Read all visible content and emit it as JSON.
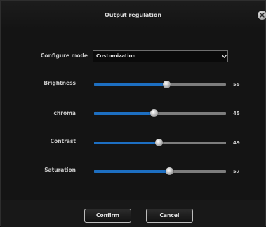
{
  "dialog": {
    "title": "Output regulation",
    "close_icon": "close-x-icon"
  },
  "configure_mode": {
    "label": "Configure mode",
    "value": "Customization",
    "arrow_icon": "chevron-down-icon"
  },
  "sliders": [
    {
      "key": "brightness",
      "label": "Brightness",
      "value": "55"
    },
    {
      "key": "chroma",
      "label": "chroma",
      "value": "45"
    },
    {
      "key": "contrast",
      "label": "Contrast",
      "value": "49"
    },
    {
      "key": "saturation",
      "label": "Saturation",
      "value": "57"
    }
  ],
  "slider_range": {
    "min": 0,
    "max": 100
  },
  "buttons": {
    "confirm": "Confirm",
    "cancel": "Cancel"
  },
  "colors": {
    "fill": "#1d6fc2",
    "track": "#7d7d7d",
    "background": "#141414"
  }
}
